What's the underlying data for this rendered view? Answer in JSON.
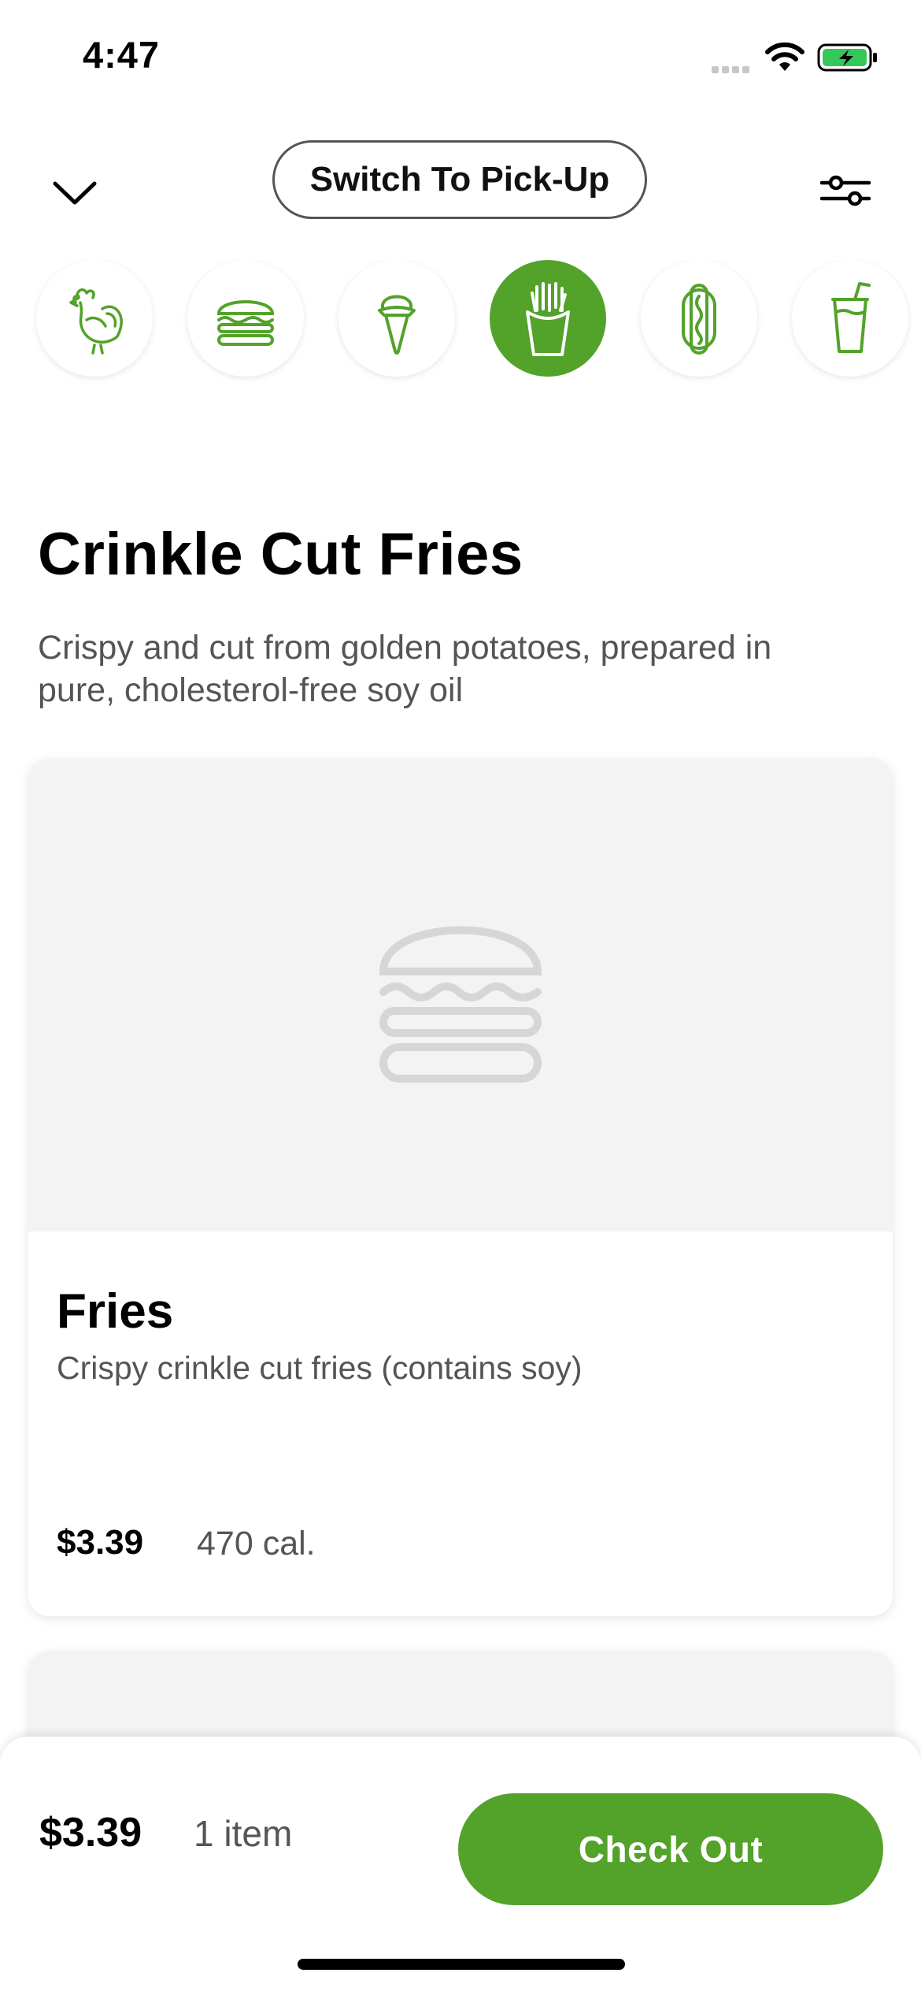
{
  "status_bar": {
    "time": "4:47"
  },
  "header": {
    "switch_label": "Switch To Pick-Up"
  },
  "categories": [
    {
      "name": "chicken",
      "icon": "chicken-icon",
      "active": false
    },
    {
      "name": "burgers",
      "icon": "burger-icon",
      "active": false
    },
    {
      "name": "frozen custard",
      "icon": "ice-cream-icon",
      "active": false
    },
    {
      "name": "fries",
      "icon": "fries-icon",
      "active": true
    },
    {
      "name": "hot dogs",
      "icon": "hot-dog-icon",
      "active": false
    },
    {
      "name": "drinks",
      "icon": "drink-cup-icon",
      "active": false
    }
  ],
  "section": {
    "title": "Crinkle Cut Fries",
    "description": "Crispy and cut from golden potatoes, prepared in pure, cholesterol-free soy oil"
  },
  "items": [
    {
      "name": "Fries",
      "description": "Crispy crinkle cut fries (contains soy)",
      "price": "$3.39",
      "calories": "470 cal.",
      "image_icon": "burger-placeholder-icon"
    }
  ],
  "cart": {
    "total": "$3.39",
    "count": "1 item",
    "checkout_label": "Check Out"
  },
  "colors": {
    "accent": "#53a22a",
    "placeholder_bg": "#f3f3f3",
    "text_secondary": "#555555"
  }
}
